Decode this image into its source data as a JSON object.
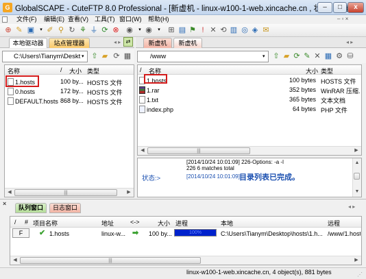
{
  "window": {
    "title": "GlobalSCAPE - CuteFTP 8.0 Professional - [新虚机 - linux-w100-1-web.xincache.cn , 状态: 已连接]",
    "minimize": "–",
    "restore": "□",
    "close": "x"
  },
  "menu": [
    {
      "label": "文件(F)"
    },
    {
      "label": "编辑(E)"
    },
    {
      "label": "查看(V)"
    },
    {
      "label": "工具(T)"
    },
    {
      "label": "窗口(W)"
    },
    {
      "label": "帮助(H)"
    }
  ],
  "toolbar_icons": [
    "connect-icon",
    "wizard-icon",
    "new-site-icon",
    "dropdown-icon",
    "edit-icon",
    "search-icon",
    "reconnect-icon",
    "tree-icon",
    "disconnect-icon",
    "refresh-icon",
    "stop-icon",
    "help-icon",
    "dropdown-icon",
    "properties-icon",
    "site-manager-icon",
    "settings-icon",
    "flag-icon",
    "delete-icon",
    "refresh-icon",
    "log-icon",
    "info-icon",
    "filter-icon",
    "mail-icon"
  ],
  "left": {
    "tabs": [
      {
        "label": "本地驱动器"
      },
      {
        "label": "站点管理器"
      }
    ],
    "path": "C:\\Users\\Tianym\\Deskt",
    "columns": {
      "name": "名称",
      "sort": "/",
      "size": "大小",
      "type": "类型"
    },
    "files": [
      {
        "name": "1.hosts",
        "size": "100 by...",
        "type": "HOSTS 文件"
      },
      {
        "name": "0.hosts",
        "size": "172 by...",
        "type": "HOSTS 文件"
      },
      {
        "name": "DEFAULT.hosts",
        "size": "868 by...",
        "type": "HOSTS 文件"
      }
    ]
  },
  "right": {
    "tabs": [
      {
        "label": "新虚机"
      },
      {
        "label": "新虚机"
      }
    ],
    "path": "/www",
    "columns": {
      "sort": "/",
      "name": "名称",
      "size": "大小",
      "type": "类型"
    },
    "files": [
      {
        "name": "1.hosts",
        "size": "100 bytes",
        "type": "HOSTS 文件",
        "icon": "file-icon"
      },
      {
        "name": "1.rar",
        "size": "352 bytes",
        "type": "WinRAR 压缩...",
        "icon": "rar-file-icon"
      },
      {
        "name": "1.txt",
        "size": "365 bytes",
        "type": "文本文档",
        "icon": "file-icon"
      },
      {
        "name": "index.php",
        "size": "64 bytes",
        "type": "PHP 文件",
        "icon": "php-file-icon"
      }
    ],
    "log": {
      "line1": "[2014/10/24 10:01:09] 226-Options: -a -l",
      "line2": "226 6 matches total",
      "status_label": "状态:>",
      "line3_time": "[2014/10/24 10:01:09]",
      "line3_msg": "目录列表已完成。"
    }
  },
  "queue": {
    "tabs": [
      {
        "label": "队列窗口"
      },
      {
        "label": "日志窗口"
      }
    ],
    "columns": {
      "sort": "/",
      "num": "#",
      "item": "项目名称",
      "addr": "地址",
      "dir": "<->",
      "size": "大小",
      "progress": "进程",
      "local": "本地",
      "remote": "远程"
    },
    "rows": [
      {
        "num": "F",
        "item": "1.hosts",
        "addr": "linux-w...",
        "dir": "➡",
        "size": "100 by...",
        "progress": "100%",
        "progress_value": 1.0,
        "local": "C:\\Users\\Tianym\\Desktop\\hosts\\1.h...",
        "remote": "/www/1.host"
      }
    ]
  },
  "statusbar": {
    "text": "linux-w100-1-web.xincache.cn, 4 object(s), 881 bytes"
  },
  "colors": {
    "accent": "#1a4fb0",
    "highlight": "#d31a1a",
    "progress": "#0022cc",
    "status_green": "#3aa12f"
  }
}
